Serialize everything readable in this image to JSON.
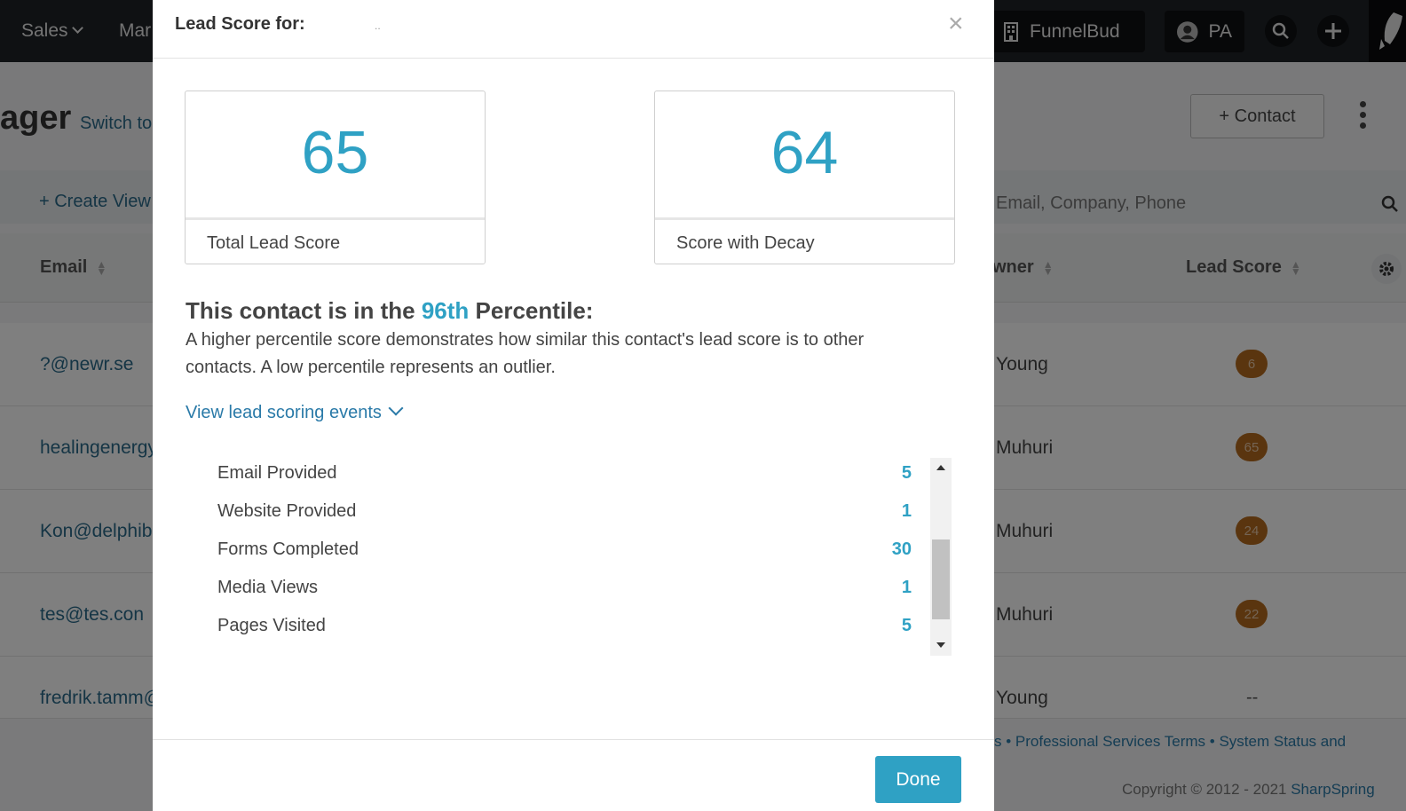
{
  "topbar": {
    "nav_sales": "Sales",
    "nav_marketing": "Mar",
    "company": "FunnelBud",
    "user_initials": "PA"
  },
  "page": {
    "title": "ager",
    "switch_link": "Switch to",
    "add_contact": "+ Contact",
    "create_view": "+ Create View",
    "search_placeholder": "Email, Company, Phone"
  },
  "table": {
    "col_email": "Email",
    "col_owner": "wner",
    "col_lead_score": "Lead Score",
    "rows": [
      {
        "email": "?@newr.se",
        "owner": "Young",
        "score": "6"
      },
      {
        "email": "healingenergy",
        "owner": "Muhuri",
        "score": "65"
      },
      {
        "email": "Kon@delphibu",
        "owner": "Muhuri",
        "score": "24"
      },
      {
        "email": "tes@tes.con",
        "owner": "Muhuri",
        "score": "22"
      },
      {
        "email": "fredrik.tamm@",
        "owner": "Young",
        "score": "--"
      }
    ]
  },
  "footer": {
    "links": "s • Professional Services Terms • System Status and",
    "copyright_prefix": "Copyright © 2012 - 2021 ",
    "copyright_brand": "SharpSpring"
  },
  "modal": {
    "title": "Lead Score for:",
    "subtitle": "..",
    "close_symbol": "×",
    "total_score": "65",
    "total_label": "Total Lead Score",
    "decay_score": "64",
    "decay_label": "Score with Decay",
    "percentile_prefix": "This contact is in the ",
    "percentile_value": "96th",
    "percentile_suffix": " Percentile:",
    "percentile_desc": "A higher percentile score demonstrates how similar this contact's lead score is to other contacts. A low percentile represents an outlier.",
    "view_events": "View lead scoring events",
    "events": [
      {
        "label": "Email Provided",
        "value": "5"
      },
      {
        "label": "Website Provided",
        "value": "1"
      },
      {
        "label": "Forms Completed",
        "value": "30"
      },
      {
        "label": "Media Views",
        "value": "1"
      },
      {
        "label": "Pages Visited",
        "value": "5"
      }
    ],
    "done": "Done"
  },
  "colors": {
    "accent": "#2fa1c4",
    "link": "#2a7aa8",
    "badge": "#b56b1e",
    "topbar": "#1e2226"
  }
}
